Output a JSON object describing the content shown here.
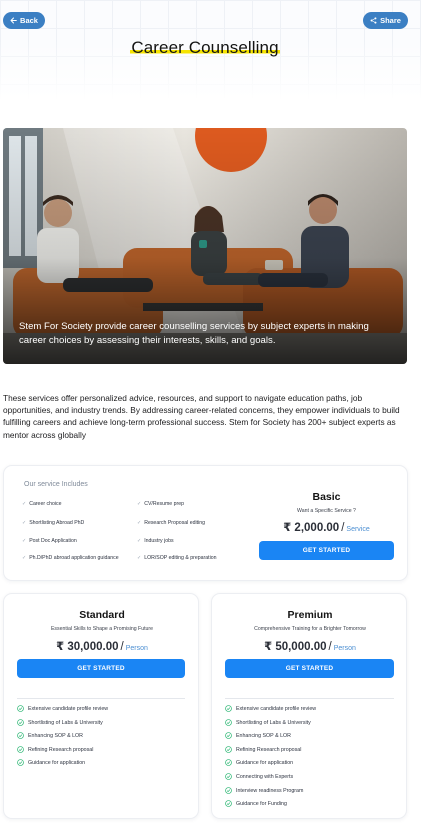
{
  "header": {
    "back_label": "Back",
    "share_label": "Share",
    "title": "Career Counselling"
  },
  "hero_image": {
    "caption": "Stem For Society provide career counselling services by subject experts in making career choices by assessing their interests, skills, and goals."
  },
  "intro": "These services offer personalized advice, resources, and support to navigate education paths, job opportunities, and industry trends. By addressing career-related concerns, they empower individuals to build fulfilling careers and achieve long-term professional success. Stem for Society has 200+ subject experts as mentor across globally",
  "services": {
    "title": "Our service Includes",
    "items": [
      "Career choice",
      "CV/Resume prep",
      "Shortlisting Abroad PhD",
      "Research Proposal editing",
      "Post Doc Application",
      "Industry jobs",
      "Ph.D/PhD abroad application guidance",
      "LOR/SOP editing & preparation"
    ]
  },
  "plans": {
    "basic": {
      "name": "Basic",
      "subtitle": "Want a Specific Service ?",
      "price": "₹ 2,000.00",
      "unit": "Service",
      "cta": "GET STARTED"
    },
    "standard": {
      "name": "Standard",
      "subtitle": "Essential Skills to Shape a Promising Future",
      "price": "₹ 30,000.00",
      "unit": "Person",
      "cta": "GET STARTED",
      "features": [
        "Extensive candidate profile review",
        "Shortlisting of Labs & University",
        "Enhancing SOP & LOR",
        "Refining Research proposal",
        "Guidance for application"
      ]
    },
    "premium": {
      "name": "Premium",
      "subtitle": "Comprehensive Training for a Brighter Tomorrow",
      "price": "₹ 50,000.00",
      "unit": "Person",
      "cta": "GET STARTED",
      "features": [
        "Extensive candidate profile review",
        "Shortlisting of Labs & University",
        "Enhancing SOP & LOR",
        "Refining Research proposal",
        "Guidance for application",
        "Connecting with Experts",
        "Interview readiness Program",
        "Guidance for Funding"
      ]
    }
  },
  "colors": {
    "pill_blue": "#3b7fc3",
    "cta_blue": "#1a85f4",
    "highlight_yellow": "#f6e400",
    "check_green": "#2bb673"
  }
}
